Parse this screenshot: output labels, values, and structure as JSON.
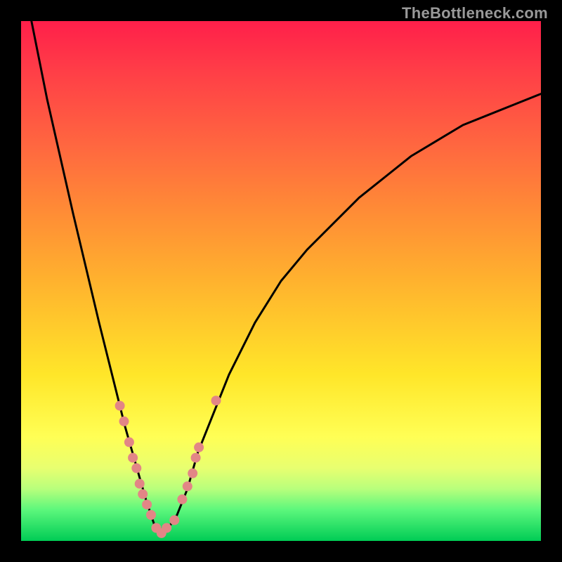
{
  "watermark": "TheBottleneck.com",
  "chart_data": {
    "type": "line",
    "title": "",
    "xlabel": "",
    "ylabel": "",
    "xlim": [
      0,
      100
    ],
    "ylim": [
      0,
      100
    ],
    "grid": false,
    "legend": false,
    "series": [
      {
        "name": "bottleneck-curve",
        "color": "#000000",
        "x": [
          2,
          5,
          10,
          15,
          18,
          20,
          22,
          24,
          25,
          26,
          27,
          28,
          30,
          32,
          34,
          36,
          40,
          45,
          50,
          55,
          60,
          65,
          70,
          75,
          80,
          85,
          90,
          95,
          100
        ],
        "y": [
          100,
          85,
          63,
          42,
          30,
          22,
          15,
          8,
          5,
          2,
          1,
          2,
          5,
          10,
          17,
          22,
          32,
          42,
          50,
          56,
          61,
          66,
          70,
          74,
          77,
          80,
          82,
          84,
          86
        ]
      }
    ],
    "points": {
      "name": "sample-points",
      "color": "#e28686",
      "radius": 7,
      "x": [
        19.0,
        19.8,
        20.8,
        21.5,
        22.2,
        22.8,
        23.4,
        24.2,
        25.0,
        26.0,
        27.0,
        28.0,
        29.5,
        31.0,
        32.0,
        33.0,
        33.6,
        34.2,
        37.5
      ],
      "y": [
        26.0,
        23.0,
        19.0,
        16.0,
        14.0,
        11.0,
        9.0,
        7.0,
        5.0,
        2.5,
        1.5,
        2.5,
        4.0,
        8.0,
        10.5,
        13.0,
        16.0,
        18.0,
        27.0
      ]
    }
  }
}
